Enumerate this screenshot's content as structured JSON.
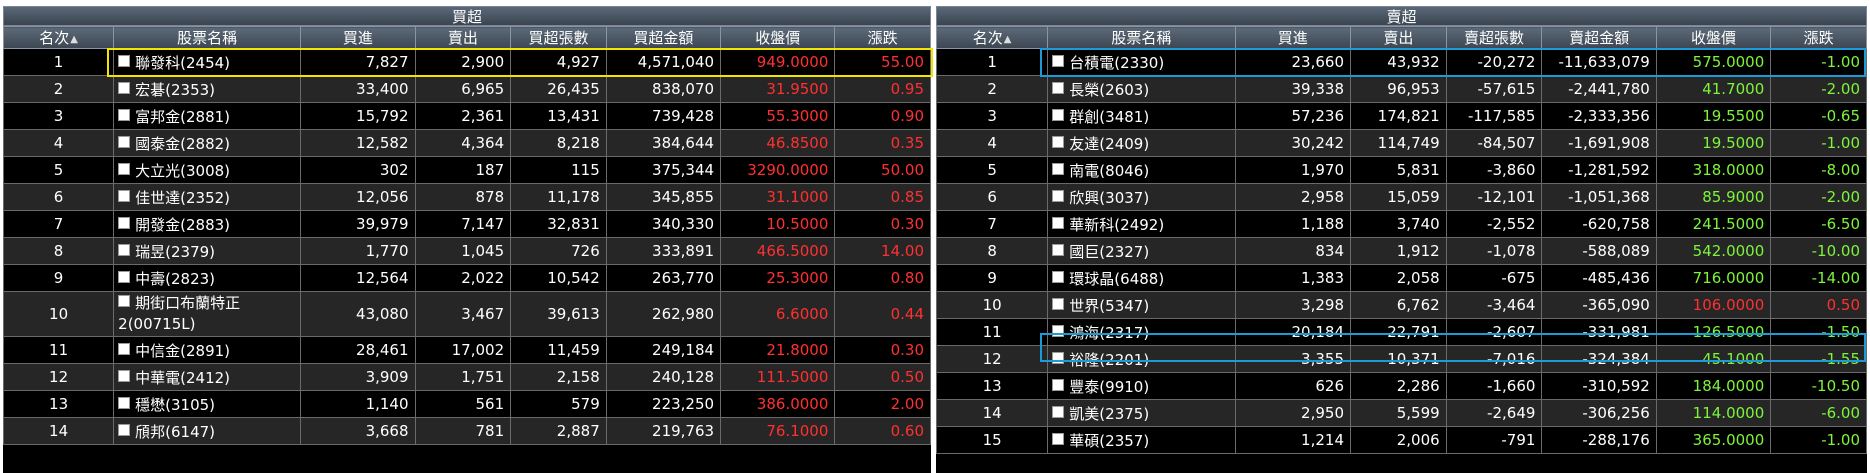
{
  "left": {
    "title": "買超",
    "headers": {
      "rank": "名次",
      "name": "股票名稱",
      "buy": "買進",
      "sell": "賣出",
      "net_lots": "買超張數",
      "net_amount": "買超金額",
      "close": "收盤價",
      "change": "漲跌"
    },
    "rows": [
      {
        "rank": "1",
        "name": "聯發科(2454)",
        "buy": "7,827",
        "sell": "2,900",
        "net_lots": "4,927",
        "net_amount": "4,571,040",
        "close": "949.0000",
        "change": "55.00",
        "dir": "up"
      },
      {
        "rank": "2",
        "name": "宏碁(2353)",
        "buy": "33,400",
        "sell": "6,965",
        "net_lots": "26,435",
        "net_amount": "838,070",
        "close": "31.9500",
        "change": "0.95",
        "dir": "up"
      },
      {
        "rank": "3",
        "name": "富邦金(2881)",
        "buy": "15,792",
        "sell": "2,361",
        "net_lots": "13,431",
        "net_amount": "739,428",
        "close": "55.3000",
        "change": "0.90",
        "dir": "up"
      },
      {
        "rank": "4",
        "name": "國泰金(2882)",
        "buy": "12,582",
        "sell": "4,364",
        "net_lots": "8,218",
        "net_amount": "384,644",
        "close": "46.8500",
        "change": "0.35",
        "dir": "up"
      },
      {
        "rank": "5",
        "name": "大立光(3008)",
        "buy": "302",
        "sell": "187",
        "net_lots": "115",
        "net_amount": "375,344",
        "close": "3290.0000",
        "change": "50.00",
        "dir": "up"
      },
      {
        "rank": "6",
        "name": "佳世達(2352)",
        "buy": "12,056",
        "sell": "878",
        "net_lots": "11,178",
        "net_amount": "345,855",
        "close": "31.1000",
        "change": "0.85",
        "dir": "up"
      },
      {
        "rank": "7",
        "name": "開發金(2883)",
        "buy": "39,979",
        "sell": "7,147",
        "net_lots": "32,831",
        "net_amount": "340,330",
        "close": "10.5000",
        "change": "0.30",
        "dir": "up"
      },
      {
        "rank": "8",
        "name": "瑞昱(2379)",
        "buy": "1,770",
        "sell": "1,045",
        "net_lots": "726",
        "net_amount": "333,891",
        "close": "466.5000",
        "change": "14.00",
        "dir": "up"
      },
      {
        "rank": "9",
        "name": "中壽(2823)",
        "buy": "12,564",
        "sell": "2,022",
        "net_lots": "10,542",
        "net_amount": "263,770",
        "close": "25.3000",
        "change": "0.80",
        "dir": "up"
      },
      {
        "rank": "10",
        "name": "期街口布蘭特正2(00715L)",
        "buy": "43,080",
        "sell": "3,467",
        "net_lots": "39,613",
        "net_amount": "262,980",
        "close": "6.6000",
        "change": "0.44",
        "dir": "up",
        "wrap": true
      },
      {
        "rank": "11",
        "name": "中信金(2891)",
        "buy": "28,461",
        "sell": "17,002",
        "net_lots": "11,459",
        "net_amount": "249,184",
        "close": "21.8000",
        "change": "0.30",
        "dir": "up"
      },
      {
        "rank": "12",
        "name": "中華電(2412)",
        "buy": "3,909",
        "sell": "1,751",
        "net_lots": "2,158",
        "net_amount": "240,128",
        "close": "111.5000",
        "change": "0.50",
        "dir": "up"
      },
      {
        "rank": "13",
        "name": "穩懋(3105)",
        "buy": "1,140",
        "sell": "561",
        "net_lots": "579",
        "net_amount": "223,250",
        "close": "386.0000",
        "change": "2.00",
        "dir": "up"
      },
      {
        "rank": "14",
        "name": "頎邦(6147)",
        "buy": "3,668",
        "sell": "781",
        "net_lots": "2,887",
        "net_amount": "219,763",
        "close": "76.1000",
        "change": "0.60",
        "dir": "up"
      }
    ]
  },
  "right": {
    "title": "賣超",
    "headers": {
      "rank": "名次",
      "name": "股票名稱",
      "buy": "買進",
      "sell": "賣出",
      "net_lots": "賣超張數",
      "net_amount": "賣超金額",
      "close": "收盤價",
      "change": "漲跌"
    },
    "rows": [
      {
        "rank": "1",
        "name": "台積電(2330)",
        "buy": "23,660",
        "sell": "43,932",
        "net_lots": "-20,272",
        "net_amount": "-11,633,079",
        "close": "575.0000",
        "change": "-1.00",
        "dir": "down"
      },
      {
        "rank": "2",
        "name": "長榮(2603)",
        "buy": "39,338",
        "sell": "96,953",
        "net_lots": "-57,615",
        "net_amount": "-2,441,780",
        "close": "41.7000",
        "change": "-2.00",
        "dir": "down"
      },
      {
        "rank": "3",
        "name": "群創(3481)",
        "buy": "57,236",
        "sell": "174,821",
        "net_lots": "-117,585",
        "net_amount": "-2,333,356",
        "close": "19.5500",
        "change": "-0.65",
        "dir": "down"
      },
      {
        "rank": "4",
        "name": "友達(2409)",
        "buy": "30,242",
        "sell": "114,749",
        "net_lots": "-84,507",
        "net_amount": "-1,691,908",
        "close": "19.5000",
        "change": "-1.00",
        "dir": "down"
      },
      {
        "rank": "5",
        "name": "南電(8046)",
        "buy": "1,970",
        "sell": "5,831",
        "net_lots": "-3,860",
        "net_amount": "-1,281,592",
        "close": "318.0000",
        "change": "-8.00",
        "dir": "down"
      },
      {
        "rank": "6",
        "name": "欣興(3037)",
        "buy": "2,958",
        "sell": "15,059",
        "net_lots": "-12,101",
        "net_amount": "-1,051,368",
        "close": "85.9000",
        "change": "-2.00",
        "dir": "down"
      },
      {
        "rank": "7",
        "name": "華新科(2492)",
        "buy": "1,188",
        "sell": "3,740",
        "net_lots": "-2,552",
        "net_amount": "-620,758",
        "close": "241.5000",
        "change": "-6.50",
        "dir": "down"
      },
      {
        "rank": "8",
        "name": "國巨(2327)",
        "buy": "834",
        "sell": "1,912",
        "net_lots": "-1,078",
        "net_amount": "-588,089",
        "close": "542.0000",
        "change": "-10.00",
        "dir": "down"
      },
      {
        "rank": "9",
        "name": "環球晶(6488)",
        "buy": "1,383",
        "sell": "2,058",
        "net_lots": "-675",
        "net_amount": "-485,436",
        "close": "716.0000",
        "change": "-14.00",
        "dir": "down"
      },
      {
        "rank": "10",
        "name": "世界(5347)",
        "buy": "3,298",
        "sell": "6,762",
        "net_lots": "-3,464",
        "net_amount": "-365,090",
        "close": "106.0000",
        "change": "0.50",
        "dir": "up"
      },
      {
        "rank": "11",
        "name": "鴻海(2317)",
        "buy": "20,184",
        "sell": "22,791",
        "net_lots": "-2,607",
        "net_amount": "-331,981",
        "close": "126.5000",
        "change": "-1.50",
        "dir": "down"
      },
      {
        "rank": "12",
        "name": "裕隆(2201)",
        "buy": "3,355",
        "sell": "10,371",
        "net_lots": "-7,016",
        "net_amount": "-324,384",
        "close": "45.1000",
        "change": "-1.55",
        "dir": "down"
      },
      {
        "rank": "13",
        "name": "豐泰(9910)",
        "buy": "626",
        "sell": "2,286",
        "net_lots": "-1,660",
        "net_amount": "-310,592",
        "close": "184.0000",
        "change": "-10.50",
        "dir": "down"
      },
      {
        "rank": "14",
        "name": "凱美(2375)",
        "buy": "2,950",
        "sell": "5,599",
        "net_lots": "-2,649",
        "net_amount": "-306,256",
        "close": "114.0000",
        "change": "-6.00",
        "dir": "down"
      },
      {
        "rank": "15",
        "name": "華碩(2357)",
        "buy": "1,214",
        "sell": "2,006",
        "net_lots": "-791",
        "net_amount": "-288,176",
        "close": "365.0000",
        "change": "-1.00",
        "dir": "down"
      }
    ]
  },
  "colors": {
    "up": "#ff3030",
    "down": "#7cf53a",
    "highlight_left": "#f2e600",
    "highlight_right": "#1d9ad8"
  }
}
